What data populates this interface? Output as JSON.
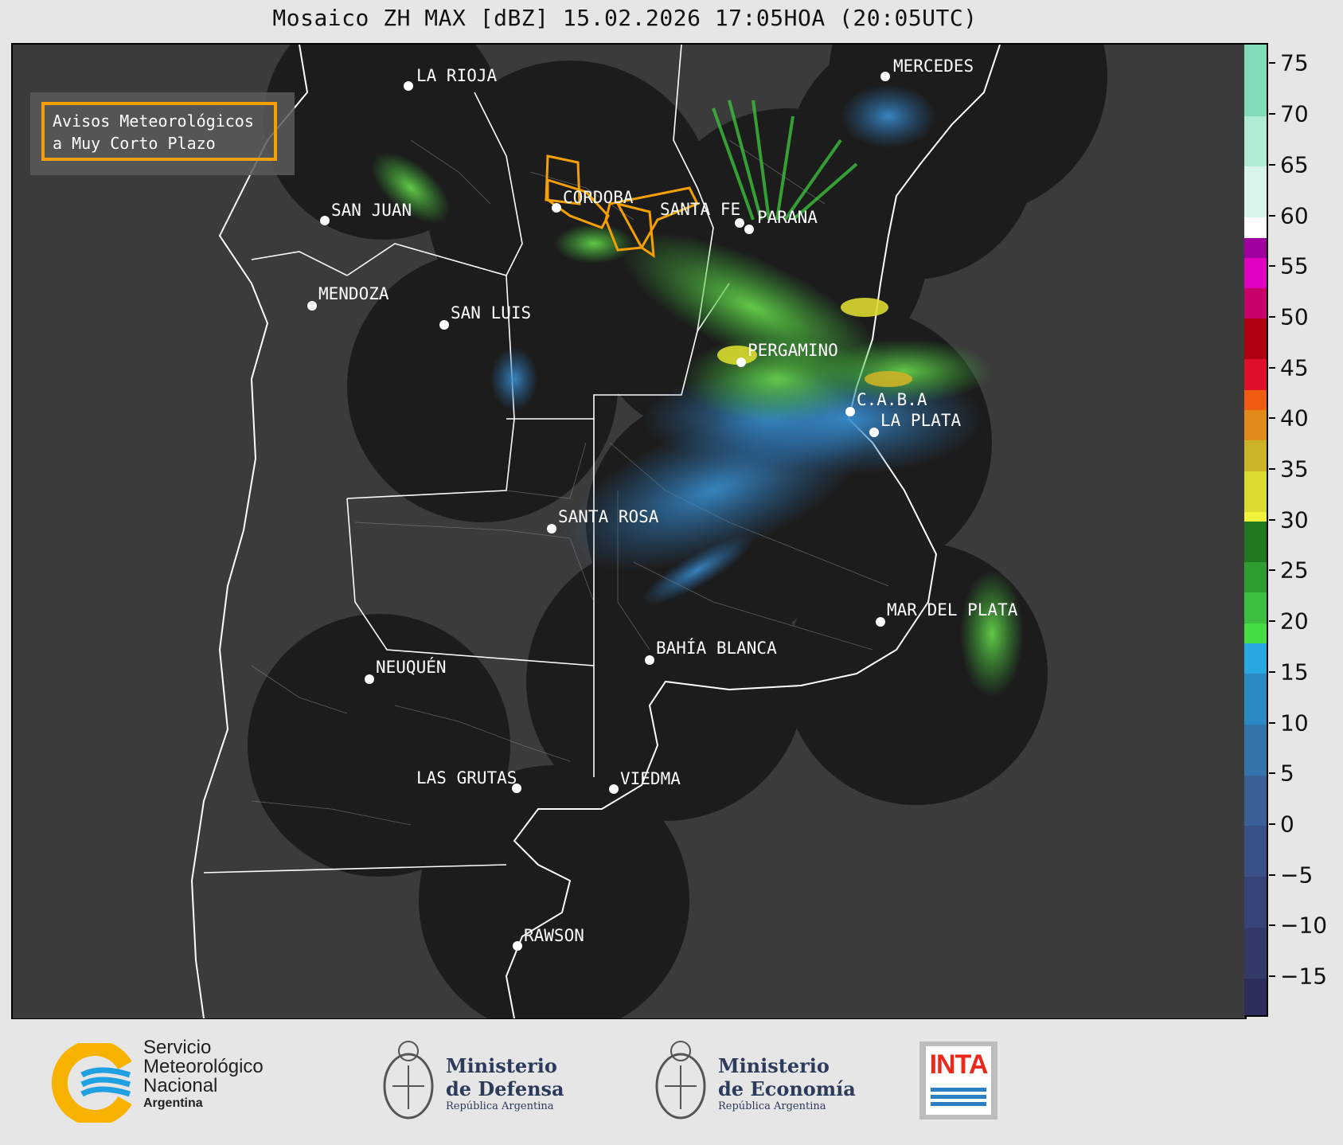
{
  "title": "Mosaico ZH MAX [dBZ] 15.02.2026 17:05HOA (20:05UTC)",
  "warning_box": {
    "line1": "Avisos Meteorológicos",
    "line2": "a Muy Corto Plazo"
  },
  "cities": [
    {
      "name": "LA RIOJA"
    },
    {
      "name": "MERCEDES"
    },
    {
      "name": "SAN JUAN"
    },
    {
      "name": "CORDOBA"
    },
    {
      "name": "SANTA FE"
    },
    {
      "name": "PARANA"
    },
    {
      "name": "MENDOZA"
    },
    {
      "name": "SAN LUIS"
    },
    {
      "name": "PERGAMINO"
    },
    {
      "name": "C.A.B.A"
    },
    {
      "name": "LA PLATA"
    },
    {
      "name": "SANTA ROSA"
    },
    {
      "name": "MAR DEL PLATA"
    },
    {
      "name": "BAHÍA BLANCA"
    },
    {
      "name": "NEUQUÉN"
    },
    {
      "name": "LAS GRUTAS"
    },
    {
      "name": "VIEDMA"
    },
    {
      "name": "RAWSON"
    }
  ],
  "colorbar": {
    "unit": "dBZ",
    "min": -19,
    "max": 77,
    "ticks": [
      "75",
      "70",
      "65",
      "60",
      "55",
      "50",
      "45",
      "40",
      "35",
      "30",
      "25",
      "20",
      "15",
      "10",
      "5",
      "0",
      "−5",
      "−10",
      "−15"
    ],
    "tick_values": [
      75,
      70,
      65,
      60,
      55,
      50,
      45,
      40,
      35,
      30,
      25,
      20,
      15,
      10,
      5,
      0,
      -5,
      -10,
      -15
    ],
    "bands": [
      {
        "from": -19,
        "to": -15,
        "color": "#2e2e5e"
      },
      {
        "from": -15,
        "to": -10,
        "color": "#333a6a"
      },
      {
        "from": -10,
        "to": -5,
        "color": "#374478"
      },
      {
        "from": -5,
        "to": 0,
        "color": "#3a5088"
      },
      {
        "from": 0,
        "to": 5,
        "color": "#3a6098"
      },
      {
        "from": 5,
        "to": 10,
        "color": "#3474ac"
      },
      {
        "from": 10,
        "to": 15,
        "color": "#2b8ac4"
      },
      {
        "from": 15,
        "to": 18,
        "color": "#27a8e0"
      },
      {
        "from": 18,
        "to": 20,
        "color": "#44dd44"
      },
      {
        "from": 20,
        "to": 23,
        "color": "#3cbf3c"
      },
      {
        "from": 23,
        "to": 26,
        "color": "#2e9e2e"
      },
      {
        "from": 26,
        "to": 30,
        "color": "#1f7a1f"
      },
      {
        "from": 30,
        "to": 31,
        "color": "#f2f23a"
      },
      {
        "from": 31,
        "to": 35,
        "color": "#dada30"
      },
      {
        "from": 35,
        "to": 38,
        "color": "#ccb326"
      },
      {
        "from": 38,
        "to": 41,
        "color": "#e08a1a"
      },
      {
        "from": 41,
        "to": 43,
        "color": "#f05d12"
      },
      {
        "from": 43,
        "to": 46,
        "color": "#e0102a"
      },
      {
        "from": 46,
        "to": 50,
        "color": "#b00010"
      },
      {
        "from": 50,
        "to": 53,
        "color": "#c8006a"
      },
      {
        "from": 53,
        "to": 56,
        "color": "#e000c0"
      },
      {
        "from": 56,
        "to": 58,
        "color": "#a000a0"
      },
      {
        "from": 58,
        "to": 60,
        "color": "#ffffff"
      },
      {
        "from": 60,
        "to": 65,
        "color": "#d8f5ea"
      },
      {
        "from": 65,
        "to": 70,
        "color": "#b0ecd4"
      },
      {
        "from": 70,
        "to": 77,
        "color": "#7edcb8"
      }
    ]
  },
  "logos": {
    "smn_line1": "Servicio",
    "smn_line2": "Meteorológico",
    "smn_line3": "Nacional",
    "smn_line4": "Argentina",
    "defensa_line1": "Ministerio",
    "defensa_line2": "de Defensa",
    "defensa_line3": "República Argentina",
    "economia_line1": "Ministerio",
    "economia_line2": "de Economía",
    "economia_line3": "República Argentina",
    "inta": "INTA"
  },
  "colors": {
    "warning_outline": "#f5a000",
    "radar_coverage": "#1b1b1b",
    "background_land": "#3a3a3a",
    "border": "#ffffff"
  }
}
